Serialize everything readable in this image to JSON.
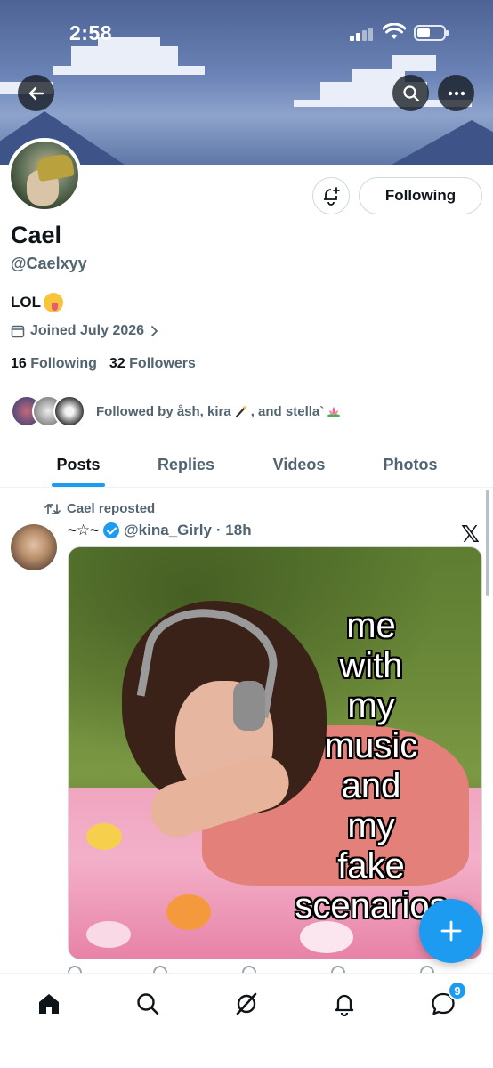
{
  "status_bar": {
    "time": "2:58"
  },
  "profile": {
    "name": "Cael",
    "handle": "@Caelxyy",
    "bio": "LOL",
    "joined": "Joined July 2026",
    "following_count": "16",
    "following_label": "Following",
    "followers_count": "32",
    "followers_label": "Followers",
    "followed_by": "Followed by åsh, kira",
    "followed_by_tail": ", and stella`"
  },
  "actions": {
    "following_button": "Following"
  },
  "tabs": [
    {
      "label": "Posts",
      "active": true
    },
    {
      "label": "Replies",
      "active": false
    },
    {
      "label": "Videos",
      "active": false
    },
    {
      "label": "Photos",
      "active": false
    }
  ],
  "post": {
    "repost_label": "Cael reposted",
    "author_name": "~☆~",
    "author_handle": "@kina_Girly",
    "time": "· 18h",
    "platform_mark": "𝕏",
    "meme_lines": [
      "me",
      "with",
      "my",
      "music",
      "and",
      "my",
      "fake",
      "scenarios"
    ]
  },
  "nav": {
    "messages_badge": "9"
  },
  "colors": {
    "accent": "#1d9bf0",
    "text_primary": "#0f1419",
    "text_secondary": "#536471"
  },
  "icons": [
    "back-arrow-icon",
    "search-icon",
    "more-icon",
    "bell-plus-icon",
    "calendar-icon",
    "chevron-right-icon",
    "repost-icon",
    "verified-badge-icon",
    "x-logo-icon",
    "plus-icon",
    "home-icon",
    "explore-icon",
    "grok-icon",
    "notifications-icon",
    "messages-icon"
  ]
}
